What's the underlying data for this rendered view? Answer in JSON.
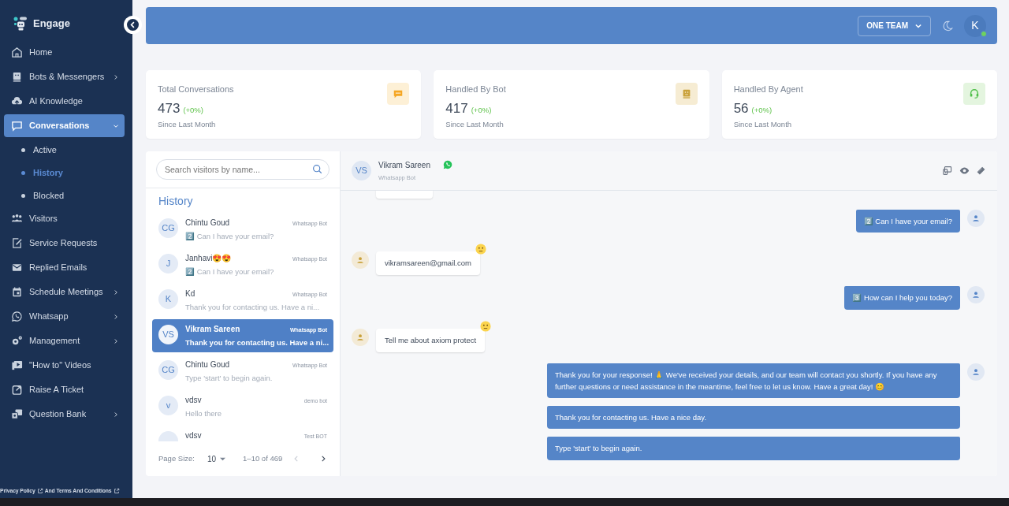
{
  "brand": {
    "name": "Engage"
  },
  "nav": [
    {
      "label": "Home",
      "expandable": false,
      "selected": false
    },
    {
      "label": "Bots & Messengers",
      "expandable": true,
      "expanded": false,
      "selected": false
    },
    {
      "label": "AI Knowledge",
      "expandable": false,
      "selected": false
    },
    {
      "label": "Conversations",
      "expandable": true,
      "expanded": true,
      "selected": true,
      "children": [
        {
          "label": "Active",
          "selected": false
        },
        {
          "label": "History",
          "selected": true
        },
        {
          "label": "Blocked",
          "selected": false
        }
      ]
    },
    {
      "label": "Visitors",
      "expandable": false,
      "selected": false
    },
    {
      "label": "Service Requests",
      "expandable": false,
      "selected": false
    },
    {
      "label": "Replied Emails",
      "expandable": false,
      "selected": false
    },
    {
      "label": "Schedule Meetings",
      "expandable": true,
      "expanded": false,
      "selected": false
    },
    {
      "label": "Whatsapp",
      "expandable": true,
      "expanded": false,
      "selected": false
    },
    {
      "label": "Management",
      "expandable": true,
      "expanded": false,
      "selected": false
    },
    {
      "label": "\"How to\" Videos",
      "expandable": false,
      "selected": false
    },
    {
      "label": "Raise A Ticket",
      "expandable": false,
      "selected": false
    },
    {
      "label": "Question Bank",
      "expandable": true,
      "expanded": false,
      "selected": false
    }
  ],
  "footer_links": [
    "Privacy Policy",
    "And Terms And Conditions"
  ],
  "header": {
    "team": "ONE TEAM",
    "user_initial": "K",
    "online": true
  },
  "stats": [
    {
      "kind": "conversations",
      "title": "Total Conversations",
      "value": "473",
      "change": "(+0%)",
      "caption": "Since Last Month"
    },
    {
      "kind": "bot",
      "title": "Handled By Bot",
      "value": "417",
      "change": "(+0%)",
      "caption": "Since Last Month"
    },
    {
      "kind": "agent",
      "title": "Handled By Agent",
      "value": "56",
      "change": "(+0%)",
      "caption": "Since Last Month"
    }
  ],
  "search": {
    "placeholder": "Search visitors by name..."
  },
  "list_title": "History",
  "visitors": [
    {
      "initials": "CG",
      "name": "Chintu Goud",
      "channel": "Whatsapp Bot",
      "message": "2️⃣ Can I have your email?",
      "selected": false
    },
    {
      "initials": "J",
      "name": "Janhavi😍😍",
      "channel": "Whatsapp Bot",
      "message": "2️⃣ Can I have your email?",
      "selected": false
    },
    {
      "initials": "K",
      "name": "Kd",
      "channel": "Whatsapp Bot",
      "message": "Thank you for contacting us. Have a ni...",
      "selected": false
    },
    {
      "initials": "VS",
      "name": "Vikram Sareen",
      "channel": "Whatsapp Bot",
      "message": "Thank you for contacting us. Have a ni...",
      "selected": true
    },
    {
      "initials": "CG",
      "name": "Chintu Goud",
      "channel": "Whatsapp Bot",
      "message": "Type 'start' to begin again.",
      "selected": false
    },
    {
      "initials": "v",
      "name": "vdsv",
      "channel": "demo bot",
      "message": "Hello there",
      "selected": false
    },
    {
      "name": "vdsv",
      "channel": "Test BOT",
      "selected": false
    }
  ],
  "pagination": {
    "label": "Page Size:",
    "size": "10",
    "range": "1–10 of 469",
    "prev_disabled": true
  },
  "chat": {
    "initials": "VS",
    "name": "Vikram Sareen",
    "channel": "Whatsapp Bot",
    "messages": [
      {
        "kind": "clipped"
      },
      {
        "kind": "bot",
        "text": "2️⃣ Can I have your email?"
      },
      {
        "kind": "visitor",
        "text": "vikramsareen@gmail.com",
        "sentiment_shown": true
      },
      {
        "kind": "bot",
        "text": "3️⃣ How can I help you today?"
      },
      {
        "kind": "visitor",
        "text": "Tell me about axiom protect",
        "sentiment_shown": true
      },
      {
        "kind": "bot",
        "text": "Thank you for your response! 🙏 We've received your details, and our team will contact you shortly. If you have any further questions or need assistance in the meantime, feel free to let us know. Have a great day! 😊"
      },
      {
        "kind": "bot",
        "text": "Thank you for contacting us. Have a nice day."
      },
      {
        "kind": "bot",
        "text": "Type 'start' to begin again."
      }
    ]
  }
}
